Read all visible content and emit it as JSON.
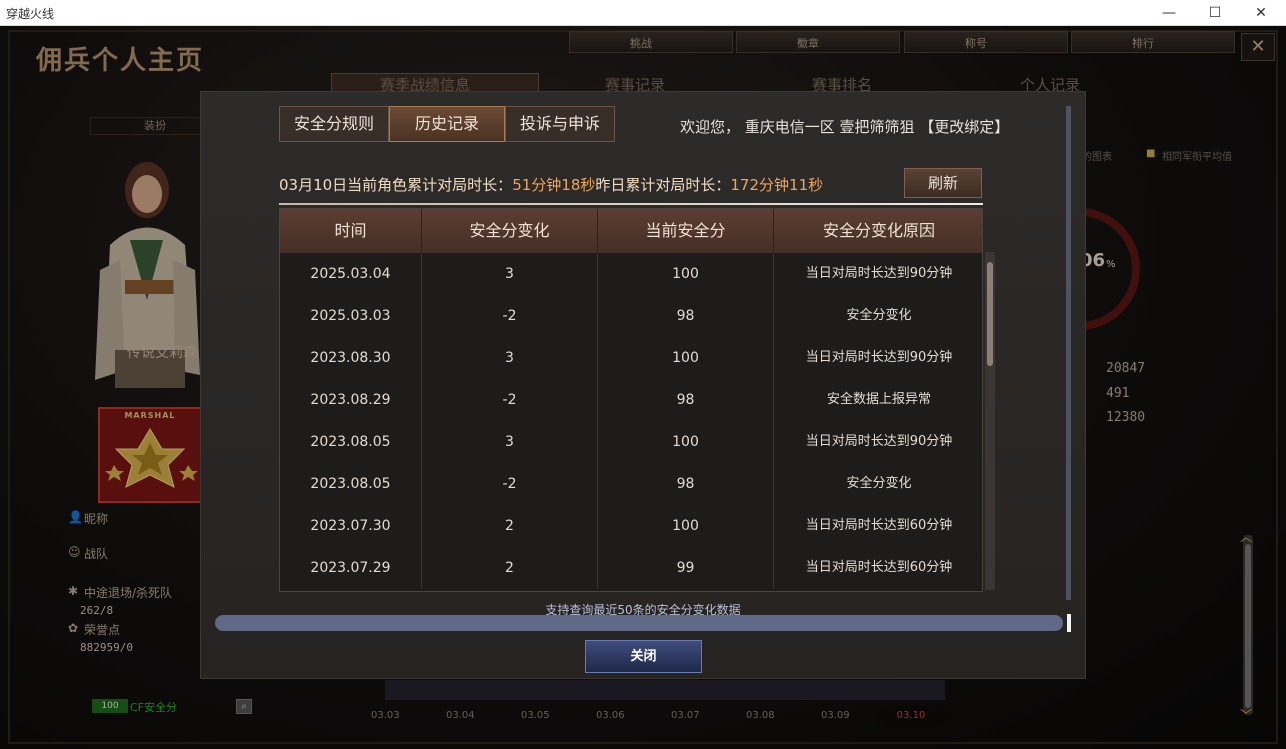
{
  "window": {
    "title": "穿越火线",
    "minimize": "—",
    "maximize": "☐",
    "close": "✕"
  },
  "background": {
    "page_title": "佣兵个人主页",
    "nav": [
      {
        "label": "挑战"
      },
      {
        "label": "徽章"
      },
      {
        "label": "称号"
      },
      {
        "label": "排行"
      }
    ],
    "tabs": [
      "赛季战绩信息",
      "赛事记录",
      "赛事排名",
      "个人记录"
    ],
    "equip_label": "装扮",
    "hero_name": "传说艾莉森",
    "rank_title": "MARSHAL",
    "side": {
      "nickname_label": "昵称",
      "team_label": "战队",
      "quit_label": "中途退场/杀死队",
      "quit_value": "262/8",
      "honor_label": "荣誉点",
      "honor_value": "882959/0"
    },
    "legend_right_1": "的图表",
    "legend_right_2": "相同军衔平均值",
    "donut_value": "06",
    "donut_unit": "%",
    "right_stats": [
      "20847",
      "491",
      "12380"
    ],
    "security": {
      "score": "100",
      "label": "CF安全分"
    },
    "dates": [
      "03.03",
      "03.04",
      "03.05",
      "03.06",
      "03.07",
      "03.08",
      "03.09",
      "03.10"
    ]
  },
  "modal": {
    "tabs": [
      "安全分规则",
      "历史记录",
      "投诉与申诉"
    ],
    "active_tab": 1,
    "welcome": "欢迎您， 重庆电信一区 壹把筛筛狙 【更改绑定】",
    "info": {
      "date_text": "03月10日当前角色累计对局时长：",
      "today_duration": "51分钟18秒",
      "yesterday_text": "昨日累计对局时长：",
      "yesterday_duration": "172分钟11秒"
    },
    "refresh_label": "刷新",
    "table": {
      "headers": [
        "时间",
        "安全分变化",
        "当前安全分",
        "安全分变化原因"
      ],
      "rows": [
        [
          "2025.03.04",
          "3",
          "100",
          "当日对局时长达到90分钟"
        ],
        [
          "2025.03.03",
          "-2",
          "98",
          "安全分变化"
        ],
        [
          "2023.08.30",
          "3",
          "100",
          "当日对局时长达到90分钟"
        ],
        [
          "2023.08.29",
          "-2",
          "98",
          "安全数据上报异常"
        ],
        [
          "2023.08.05",
          "3",
          "100",
          "当日对局时长达到90分钟"
        ],
        [
          "2023.08.05",
          "-2",
          "98",
          "安全分变化"
        ],
        [
          "2023.07.30",
          "2",
          "100",
          "当日对局时长达到60分钟"
        ],
        [
          "2023.07.29",
          "2",
          "99",
          "当日对局时长达到60分钟"
        ]
      ]
    },
    "note": "支持查询最近50条的安全分变化数据",
    "close_label": "关闭"
  }
}
